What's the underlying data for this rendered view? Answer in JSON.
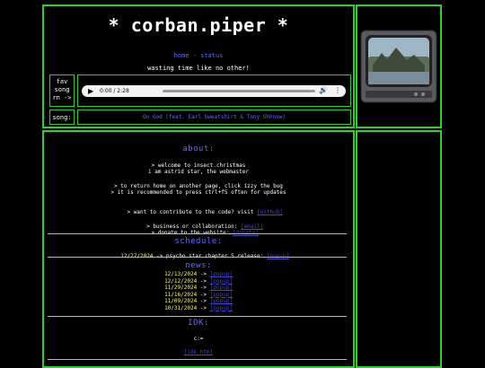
{
  "header": {
    "title": "* corban.piper *",
    "nav": "home - status",
    "tagline": "wasting time like no other!"
  },
  "music": {
    "label_fav": "fav\nsong\nrn ->",
    "time": "0:00 / 2:28",
    "label_song": "song:",
    "song_title": "On God (feat. Earl Sweatshirt & Tony Shhnow)"
  },
  "about": {
    "heading": "about:",
    "line1": "> welcome to insect.christmas",
    "line2": "i am astrid star, the webmaster",
    "line3": "> to return home on another page, click izzy the bug",
    "line4": "> it is recommended to press ctrl+f5 often for updates",
    "line5_text": "> want to contribute to the code? visit ",
    "line5_link": "[github]",
    "line6_text": "> business or collaboration: ",
    "line6_link": "[email]",
    "line7_text": "> donate to the website: ",
    "line7_link": "[donate]"
  },
  "schedule": {
    "heading": "schedule:",
    "date": "12/27/2024",
    "text": " -> psycho star chapter 5 release: ",
    "link": "[popup]"
  },
  "news": {
    "heading": "news:",
    "items": [
      {
        "date": "12/13/2024",
        "arrow": " -> ",
        "link": "[popup]"
      },
      {
        "date": "12/12/2024",
        "arrow": " -> ",
        "link": "[popup]"
      },
      {
        "date": "11/29/2024",
        "arrow": " -> ",
        "link": "[popup]"
      },
      {
        "date": "11/16/2024",
        "arrow": " -> ",
        "link": "[popup]"
      },
      {
        "date": "11/09/2024",
        "arrow": " -> ",
        "link": "[popup]"
      },
      {
        "date": "10/31/2024",
        "arrow": " -> ",
        "link": "[popup]"
      }
    ]
  },
  "idk": {
    "heading": "IDK:",
    "text": "c:=",
    "link": "[idk.htm]"
  },
  "colors": {
    "border": "#33cc33",
    "link": "#6666ff",
    "date": "#ffff66",
    "background": "#000000"
  }
}
